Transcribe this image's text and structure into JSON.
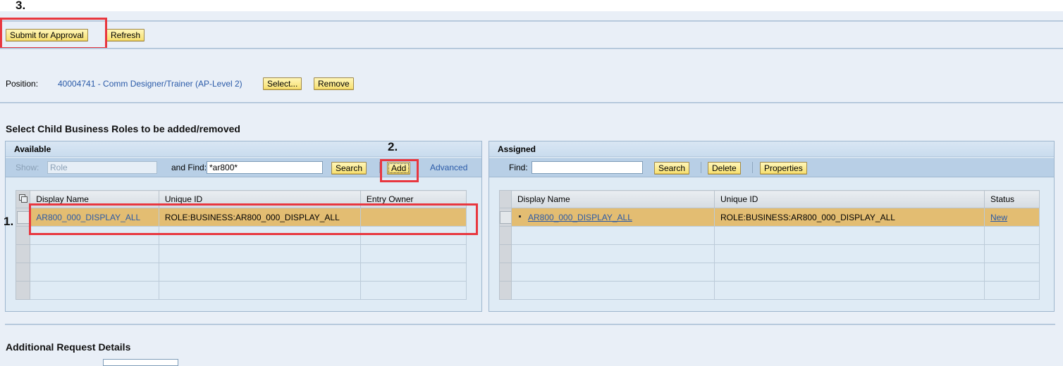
{
  "annotations": {
    "step1": "1.",
    "step2": "2.",
    "step3": "3."
  },
  "toolbar": {
    "submit_label": "Submit for Approval",
    "refresh_label": "Refresh"
  },
  "position": {
    "label": "Position:",
    "value": "40004741 - Comm Designer/Trainer (AP-Level 2)",
    "select_label": "Select...",
    "remove_label": "Remove"
  },
  "section_title": "Select Child Business Roles to be added/removed",
  "available": {
    "title": "Available",
    "show_label": "Show:",
    "show_value": "Role",
    "find_label": "and Find:",
    "find_value": "*ar800*",
    "search_label": "Search",
    "add_label": "Add",
    "advanced_label": "Advanced",
    "columns": [
      "Display Name",
      "Unique ID",
      "Entry Owner"
    ],
    "rows": [
      {
        "display_name": "AR800_000_DISPLAY_ALL",
        "unique_id": "ROLE:BUSINESS:AR800_000_DISPLAY_ALL",
        "entry_owner": "",
        "selected": true
      }
    ]
  },
  "assigned": {
    "title": "Assigned",
    "find_label": "Find:",
    "find_value": "",
    "search_label": "Search",
    "delete_label": "Delete",
    "properties_label": "Properties",
    "columns": [
      "Display Name",
      "Unique ID",
      "Status"
    ],
    "rows": [
      {
        "display_name": "AR800_000_DISPLAY_ALL",
        "unique_id": "ROLE:BUSINESS:AR800_000_DISPLAY_ALL",
        "status": "New",
        "selected": true
      }
    ]
  },
  "additional_title": "Additional Request Details",
  "icons": {
    "multi_select": "multi-select-icon",
    "bullet": "bullet-icon"
  },
  "colors": {
    "background": "#e9eff7",
    "button": "#f7df6e",
    "selected_row": "#e3bd72",
    "link": "#2a5aa8",
    "highlight_box": "#e8373f"
  }
}
